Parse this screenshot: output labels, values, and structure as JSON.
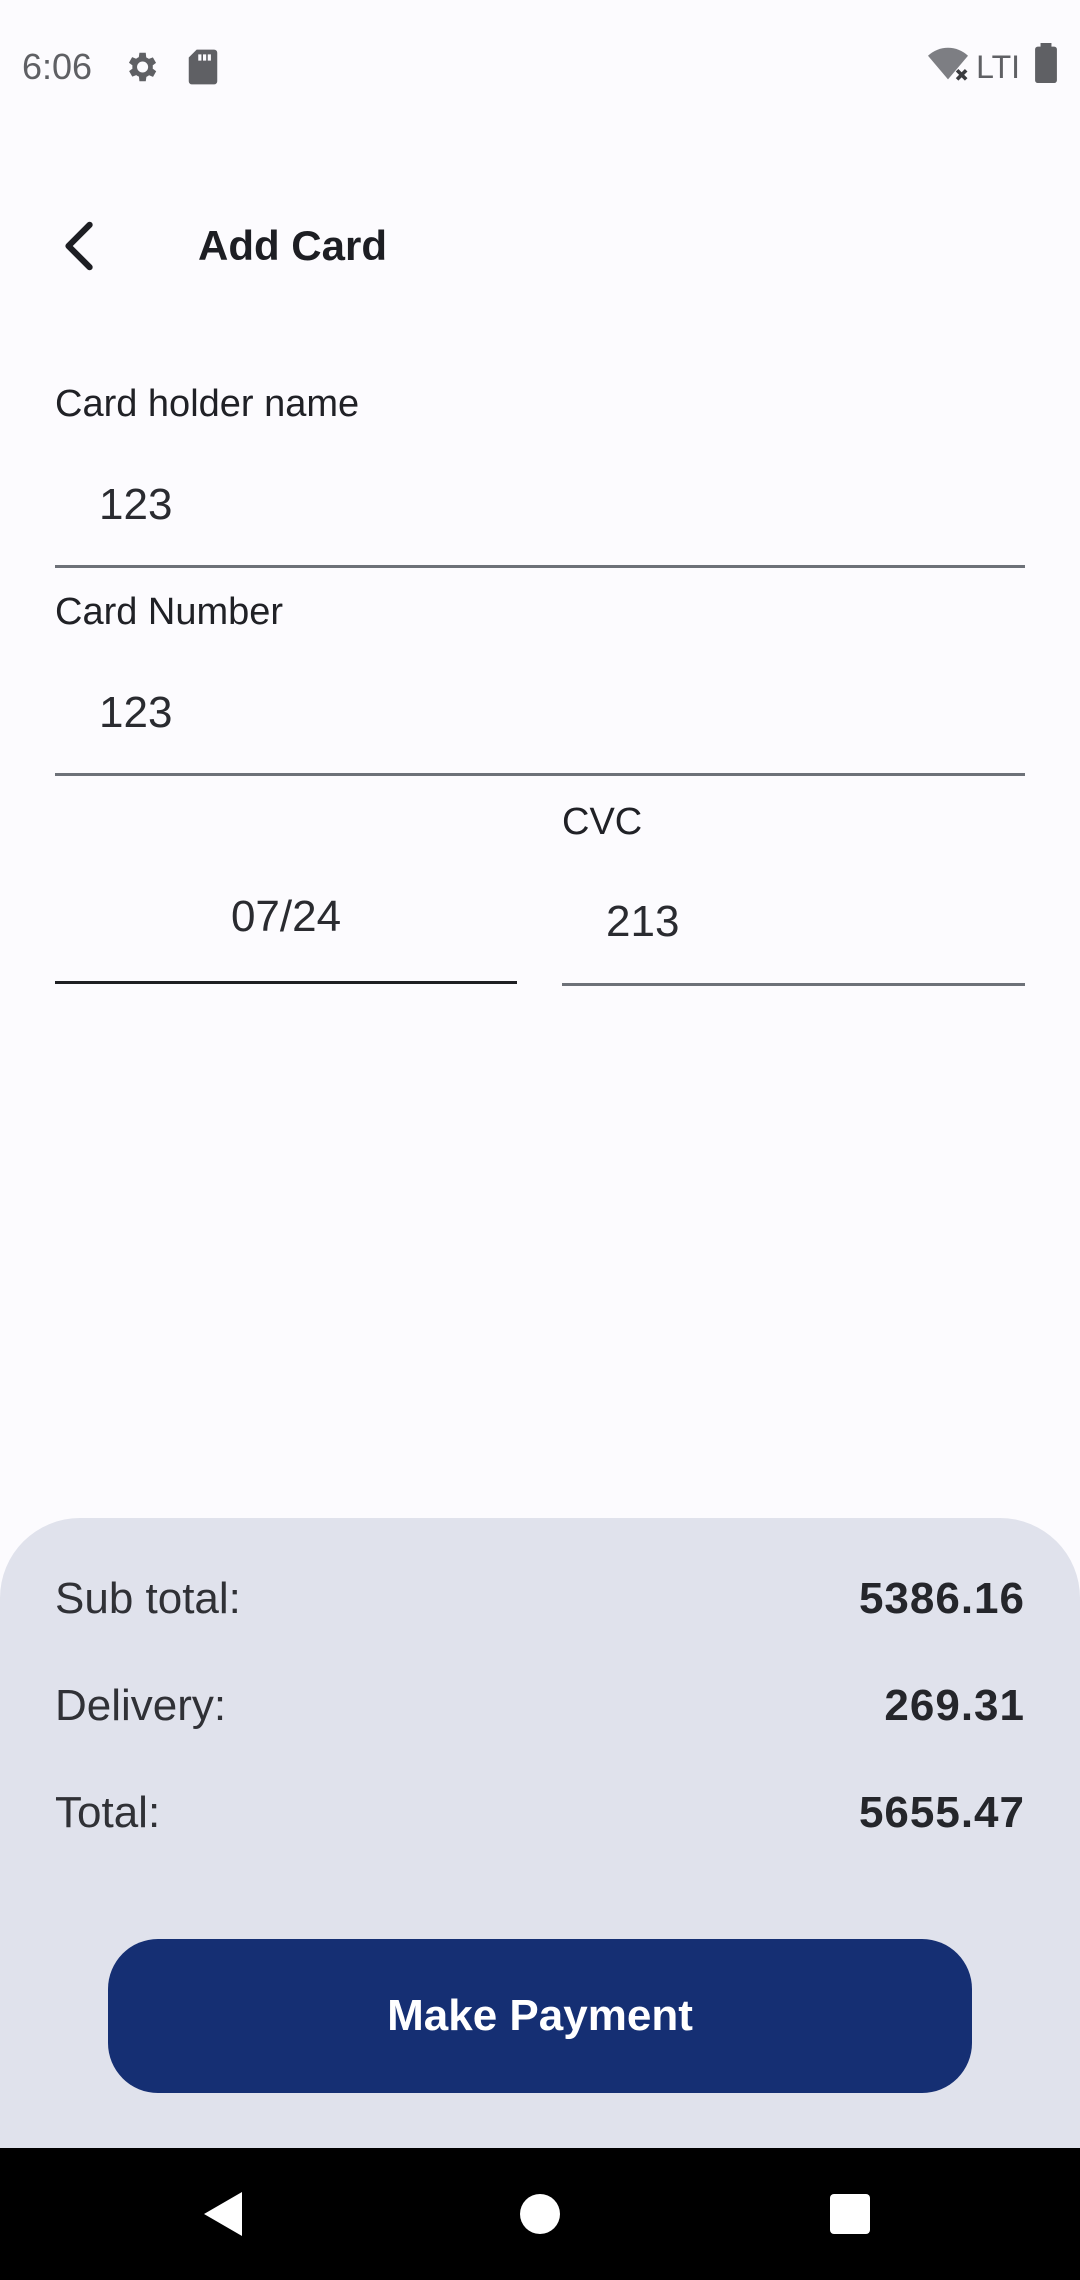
{
  "status_bar": {
    "time": "6:06",
    "network_label": "LTI",
    "icons": [
      "settings-icon",
      "sd-card-icon",
      "wifi-off-icon",
      "battery-icon"
    ]
  },
  "header": {
    "title": "Add Card",
    "back_icon": "chevron-left-icon"
  },
  "form": {
    "holder_label": "Card holder name",
    "holder_value": "123",
    "number_label": "Card Number",
    "number_value": "123",
    "expiry_value": "07/24",
    "cvc_label": "CVC",
    "cvc_value": "213"
  },
  "summary": {
    "subtotal_label": "Sub total:",
    "subtotal_value": "5386.16",
    "delivery_label": "Delivery:",
    "delivery_value": "269.31",
    "total_label": "Total:",
    "total_value": "5655.47",
    "pay_button_label": "Make Payment"
  },
  "nav": {
    "icons": [
      "back-triangle-icon",
      "home-circle-icon",
      "recents-square-icon"
    ]
  },
  "colors": {
    "accent": "#152f73",
    "summary_bg": "#e0e2ec",
    "page_bg": "#fcfbfe"
  }
}
